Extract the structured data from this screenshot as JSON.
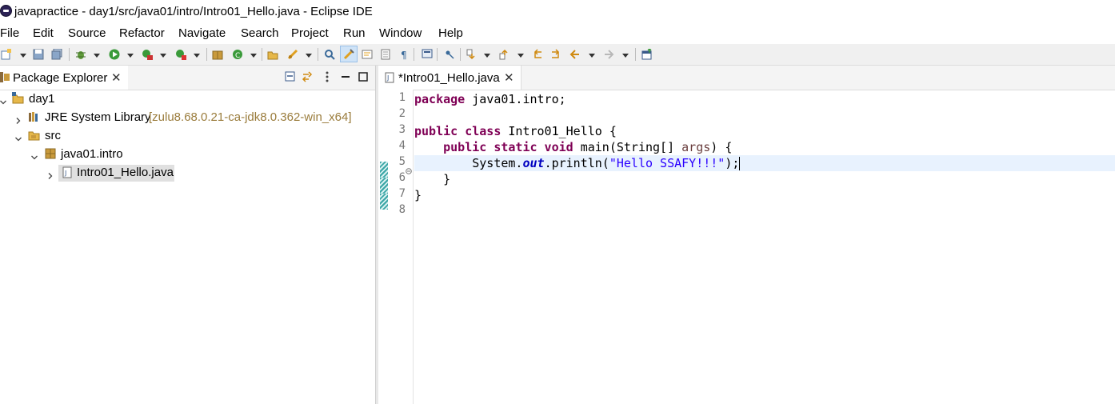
{
  "window": {
    "title": "javapractice - day1/src/java01/intro/Intro01_Hello.java - Eclipse IDE"
  },
  "menu": [
    "File",
    "Edit",
    "Source",
    "Refactor",
    "Navigate",
    "Search",
    "Project",
    "Run",
    "Window",
    "Help"
  ],
  "toolbar_icons": [
    "new-wizard-icon",
    "save-icon",
    "save-all-icon",
    "debug-icon",
    "run-icon",
    "coverage-icon",
    "external-tools-icon",
    "new-java-package-icon",
    "new-java-class-icon",
    "open-type-icon",
    "search-icon",
    "toggle-mark-occurrences-icon",
    "toggle-highlight-icon",
    "toggle-block-selection-icon",
    "toggle-word-wrap-icon",
    "show-whitespace-icon",
    "open-console-icon",
    "pin-icon",
    "next-annotation-icon",
    "previous-annotation-icon",
    "last-edit-location-icon",
    "back-icon",
    "forward-icon",
    "open-perspective-icon"
  ],
  "package_explorer": {
    "title": "Package Explorer",
    "tree": [
      {
        "label": "day1",
        "icon": "java-project-icon",
        "expanded": true
      },
      {
        "label": "JRE System Library",
        "decoration": "[zulu8.68.0.21-ca-jdk8.0.362-win_x64]",
        "icon": "library-icon",
        "expanded": false
      },
      {
        "label": "src",
        "icon": "source-folder-icon",
        "expanded": true
      },
      {
        "label": "java01.intro",
        "icon": "package-icon",
        "expanded": true
      },
      {
        "label": "Intro01_Hello.java",
        "icon": "java-file-icon",
        "expanded": false,
        "selected": true
      }
    ]
  },
  "editor": {
    "tab_label": "*Intro01_Hello.java",
    "line_numbers": [
      "1",
      "2",
      "3",
      "4",
      "5",
      "6",
      "7",
      "8"
    ],
    "code": {
      "l1_kw": "package",
      "l1_rest": " java01.intro;",
      "l3_kw": "public class",
      "l3_rest": " Intro01_Hello {",
      "l4_indent": "    ",
      "l4_kw": "public static void",
      "l4_a": " main(String[] ",
      "l4_param": "args",
      "l4_b": ") {",
      "l5_a": "        System.",
      "l5_field": "out",
      "l5_b": ".println(",
      "l5_str": "\"Hello SSAFY!!!\"",
      "l5_c": ");",
      "l6": "    }",
      "l7": "}"
    }
  },
  "colors": {
    "keyword": "#7f0055",
    "string": "#2a00ff",
    "field": "#0000c0",
    "current_line": "#e8f2fe"
  }
}
